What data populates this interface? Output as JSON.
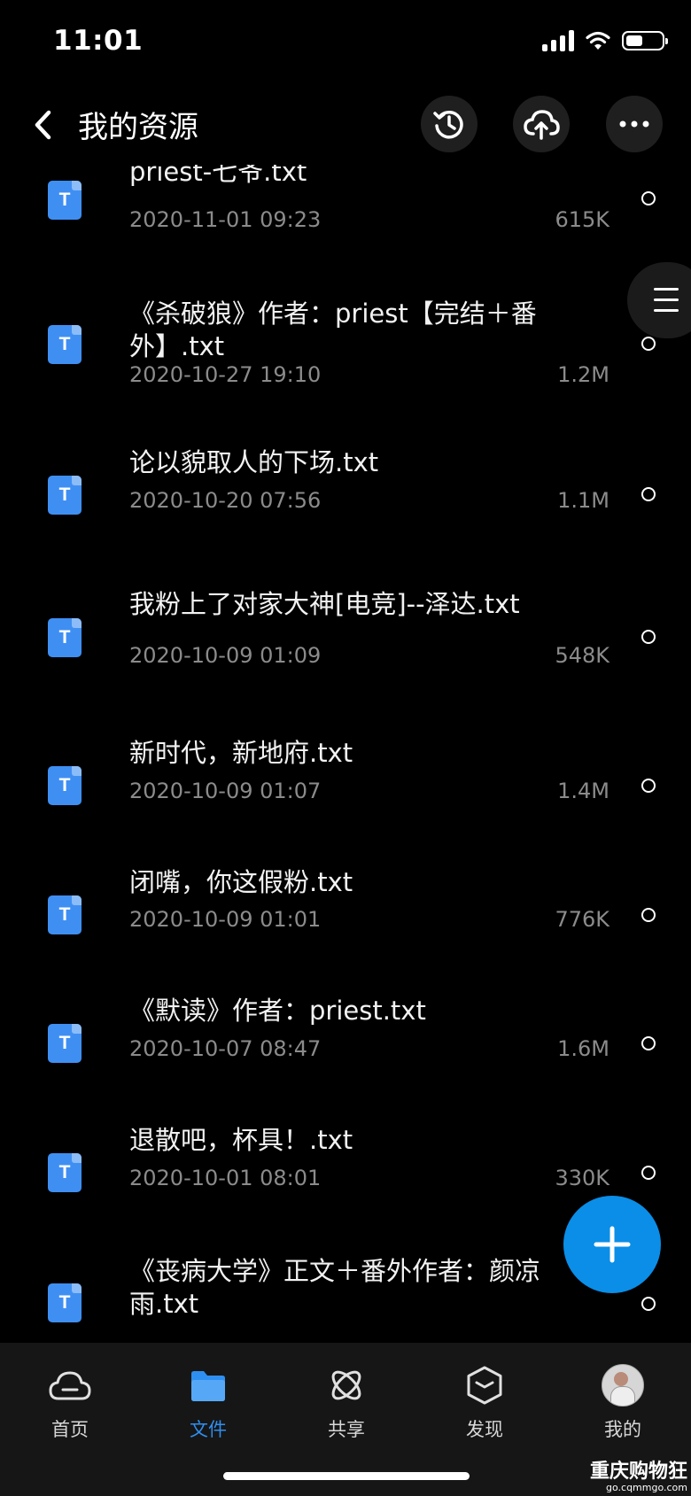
{
  "status_bar": {
    "time": "11:01",
    "battery_level": 0.45
  },
  "header": {
    "title": "我的资源"
  },
  "icons": {
    "back": "chevron-left-icon",
    "history": "history-icon",
    "cloud_upload": "cloud-upload-icon",
    "more": "more-dots-icon",
    "side_handle": "menu-lines-icon",
    "fab": "plus-icon"
  },
  "files": [
    {
      "icon_letter": "T",
      "name": "priest-七爷.txt",
      "date": "2020-11-01 09:23",
      "size": "615K"
    },
    {
      "icon_letter": "T",
      "name": "《杀破狼》作者：priest【完结＋番外】.txt",
      "date": "2020-10-27 19:10",
      "size": "1.2M"
    },
    {
      "icon_letter": "T",
      "name": "论以貌取人的下场.txt",
      "date": "2020-10-20 07:56",
      "size": "1.1M"
    },
    {
      "icon_letter": "T",
      "name": "我粉上了对家大神[电竞]--泽达.txt",
      "date": "2020-10-09 01:09",
      "size": "548K"
    },
    {
      "icon_letter": "T",
      "name": "新时代，新地府.txt",
      "date": "2020-10-09 01:07",
      "size": "1.4M"
    },
    {
      "icon_letter": "T",
      "name": "闭嘴，你这假粉.txt",
      "date": "2020-10-09 01:01",
      "size": "776K"
    },
    {
      "icon_letter": "T",
      "name": "《默读》作者：priest.txt",
      "date": "2020-10-07 08:47",
      "size": "1.6M"
    },
    {
      "icon_letter": "T",
      "name": "退散吧，杯具！.txt",
      "date": "2020-10-01 08:01",
      "size": "330K"
    },
    {
      "icon_letter": "T",
      "name": "《丧病大学》正文＋番外作者：颜凉雨.txt",
      "date": "",
      "size": ""
    }
  ],
  "tabs": [
    {
      "label": "首页",
      "icon": "cloud-home-icon",
      "active": false
    },
    {
      "label": "文件",
      "icon": "folder-icon",
      "active": true
    },
    {
      "label": "共享",
      "icon": "atom-share-icon",
      "active": false
    },
    {
      "label": "发现",
      "icon": "cube-discover-icon",
      "active": false
    },
    {
      "label": "我的",
      "icon": "avatar",
      "active": false
    }
  ],
  "watermark": {
    "main": "重庆购物狂",
    "sub": "go.cqmmgo.com"
  },
  "colors": {
    "accent": "#2f8ff0",
    "fab": "#0a8ee8",
    "file_icon": "#3f8ff3",
    "background": "#000000",
    "tab_bar": "#161616"
  }
}
